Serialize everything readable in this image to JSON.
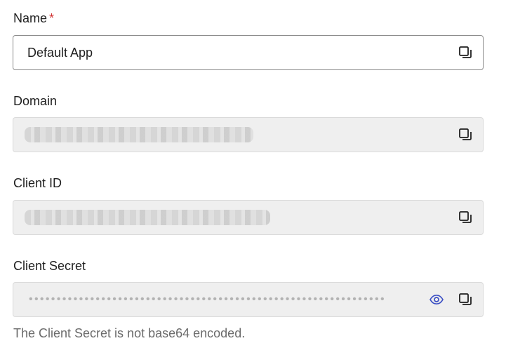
{
  "fields": {
    "name": {
      "label": "Name",
      "required_marker": "*",
      "value": "Default App"
    },
    "domain": {
      "label": "Domain",
      "value_redacted": true
    },
    "client_id": {
      "label": "Client ID",
      "value_redacted": true
    },
    "client_secret": {
      "label": "Client Secret",
      "masked_value": "••••••••••••••••••••••••••••••••••••••••••••••••••••••••••••••••",
      "helper_text": "The Client Secret is not base64 encoded."
    }
  },
  "icons": {
    "copy": "copy-icon",
    "reveal": "eye-icon"
  },
  "colors": {
    "required": "#d03030",
    "eye_icon": "#3b4fc4",
    "readonly_bg": "#efefef"
  }
}
